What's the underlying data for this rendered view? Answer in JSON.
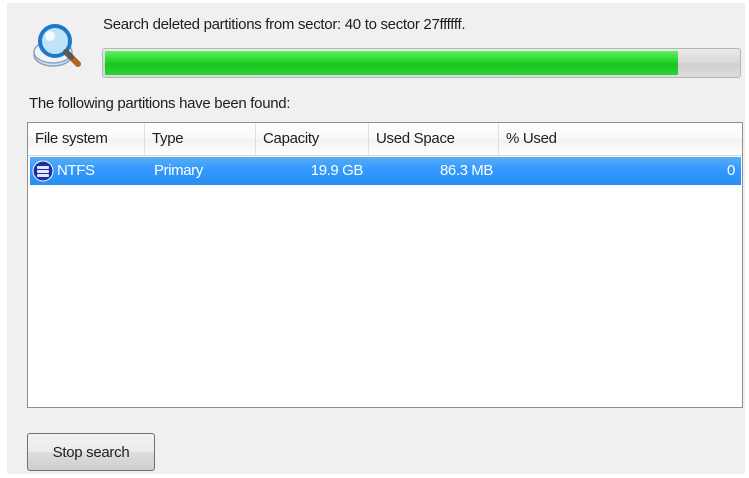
{
  "header": {
    "status_text": "Search deleted partitions from sector: 40 to sector 27ffffff.",
    "progress_fraction": 0.905
  },
  "found_label": "The following partitions have been found:",
  "columns": [
    "File system",
    "Type",
    "Capacity",
    "Used Space",
    "% Used"
  ],
  "rows": [
    {
      "file_system": "NTFS",
      "type": "Primary",
      "capacity": "19.9 GB",
      "used_space": "86.3 MB",
      "percent_used": "0",
      "icon": "drive-icon",
      "selected": true
    }
  ],
  "buttons": {
    "stop_search": "Stop search"
  },
  "colors": {
    "progress_fill": "#22d22a",
    "selection": "#3399ff",
    "panel_background": "#f0f0f0"
  },
  "icons": {
    "search": "magnifier-over-disk-icon",
    "row": "drive-icon"
  }
}
